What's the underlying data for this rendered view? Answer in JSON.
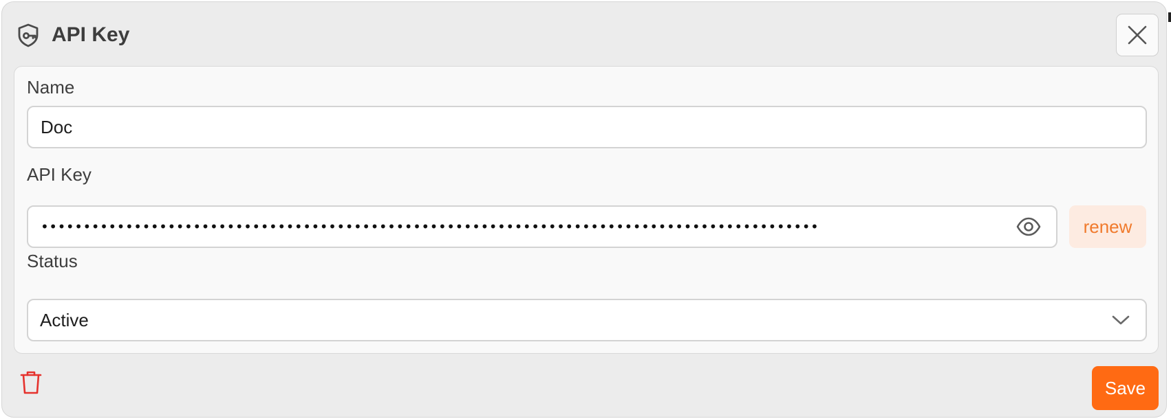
{
  "dialog": {
    "title": "API Key",
    "icon": "shield-key-icon",
    "close_icon": "close-icon"
  },
  "form": {
    "name": {
      "label": "Name",
      "value": "Doc"
    },
    "api_key": {
      "label": "API Key",
      "masked_value": "•••••••••••••••••••••••••••••••••••••••••••••••••••••••••••••••••••••••••••••••••••••••••••••••••••••••••",
      "reveal_icon": "eye-icon",
      "renew_label": "renew"
    },
    "status": {
      "label": "Status",
      "value": "Active",
      "icon": "chevron-down-icon"
    }
  },
  "footer": {
    "delete_icon": "trash-icon",
    "save_label": "Save"
  },
  "colors": {
    "accent": "#ff6a13",
    "renew_text": "#f07a2c",
    "renew_bg": "#fdebe1",
    "delete": "#e5322d",
    "dialog_bg": "#ececec",
    "card_bg": "#f9f9f9"
  }
}
